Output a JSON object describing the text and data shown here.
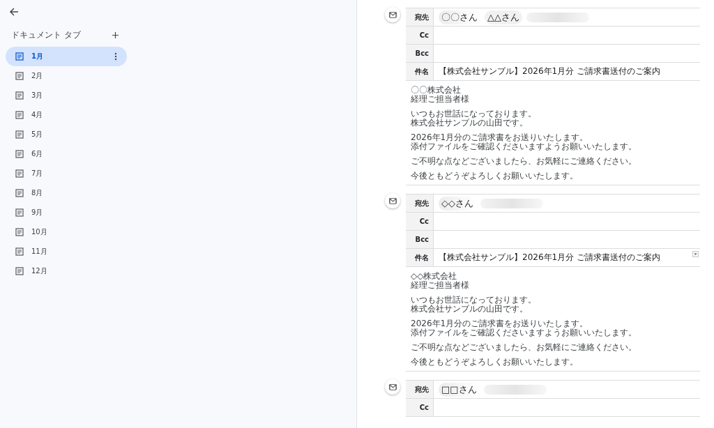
{
  "sidebar": {
    "title": "ドキュメント タブ",
    "tabs": [
      {
        "label": "1月",
        "selected": true
      },
      {
        "label": "2月",
        "selected": false
      },
      {
        "label": "3月",
        "selected": false
      },
      {
        "label": "4月",
        "selected": false
      },
      {
        "label": "5月",
        "selected": false
      },
      {
        "label": "6月",
        "selected": false
      },
      {
        "label": "7月",
        "selected": false
      },
      {
        "label": "8月",
        "selected": false
      },
      {
        "label": "9月",
        "selected": false
      },
      {
        "label": "10月",
        "selected": false
      },
      {
        "label": "11月",
        "selected": false
      },
      {
        "label": "12月",
        "selected": false
      }
    ]
  },
  "drafts": [
    {
      "fields": [
        {
          "label": "宛先",
          "kind": "recipients",
          "chips": [
            "〇〇さん",
            "△△さん"
          ],
          "redacted": true
        },
        {
          "label": "Cc",
          "kind": "text"
        },
        {
          "label": "Bcc",
          "kind": "text"
        },
        {
          "label": "件名",
          "kind": "text",
          "value": "【株式会社サンプル】2026年1月分 ご請求書送付のご案内",
          "dropdown": false
        }
      ],
      "body": [
        [
          "〇〇株式会社",
          "経理ご担当者様"
        ],
        [
          "いつもお世話になっております。",
          "株式会社サンプルの山田です。"
        ],
        [
          "2026年1月分のご請求書をお送りいたします。",
          "添付ファイルをご確認くださいますようお願いいたします。"
        ],
        [
          "ご不明な点などございましたら、お気軽にご連絡ください。"
        ],
        [
          "今後ともどうぞよろしくお願いいたします。"
        ]
      ]
    },
    {
      "fields": [
        {
          "label": "宛先",
          "kind": "recipients",
          "chips": [
            "◇◇さん"
          ],
          "redacted": true
        },
        {
          "label": "Cc",
          "kind": "text"
        },
        {
          "label": "Bcc",
          "kind": "text"
        },
        {
          "label": "件名",
          "kind": "text",
          "value": "【株式会社サンプル】2026年1月分 ご請求書送付のご案内",
          "dropdown": true
        }
      ],
      "body": [
        [
          "◇◇株式会社",
          "経理ご担当者様"
        ],
        [
          "いつもお世話になっております。",
          "株式会社サンプルの山田です。"
        ],
        [
          "2026年1月分のご請求書をお送りいたします。",
          "添付ファイルをご確認くださいますようお願いいたします。"
        ],
        [
          "ご不明な点などございましたら、お気軽にご連絡ください。"
        ],
        [
          "今後ともどうぞよろしくお願いいたします。"
        ]
      ]
    },
    {
      "fields": [
        {
          "label": "宛先",
          "kind": "recipients",
          "chips": [
            "□□さん"
          ],
          "redacted": true
        },
        {
          "label": "Cc",
          "kind": "text"
        }
      ]
    }
  ]
}
